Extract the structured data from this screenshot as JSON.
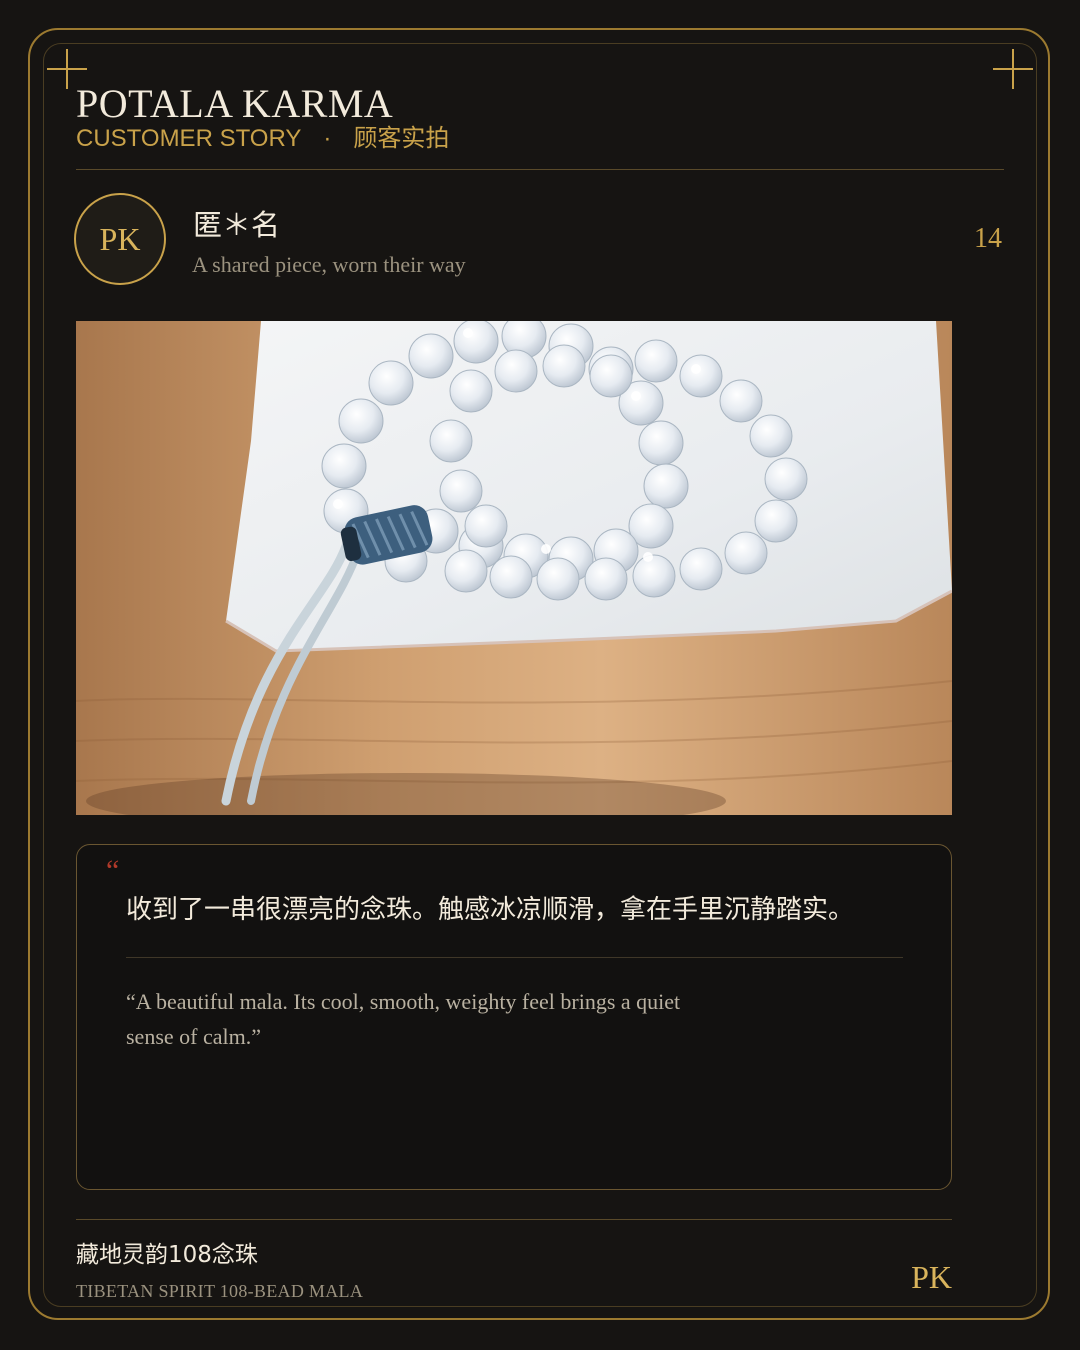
{
  "brand": {
    "name": "POTALA KARMA",
    "tagline_en": "CUSTOMER STORY",
    "tagline_separator": "·",
    "tagline_zh": "顾客实拍"
  },
  "reviewer": {
    "avatar_initials": "PK",
    "name": "匿＊名",
    "subtitle": "A shared piece, worn their way"
  },
  "story_number": "14",
  "photo": {
    "subject": "white bead mala on a white pouch over a wooden table",
    "colors": {
      "wood": "#c99a6c",
      "cloth": "#eef0f2",
      "beads": "#e7ecf2",
      "knot": "#3d5f7e"
    }
  },
  "quote": {
    "mark": "“",
    "text_zh": "收到了一串很漂亮的念珠。触感冰凉顺滑，拿在手里沉静踏实。",
    "text_en": "“A beautiful mala. Its cool, smooth, weighty feel brings a quiet sense of calm.”"
  },
  "product": {
    "name_zh": "藏地灵韵108念珠",
    "name_en": "TIBETAN SPIRIT 108-BEAD MALA"
  },
  "footer": {
    "logo": "PK"
  },
  "colors": {
    "background": "#161412",
    "gold": "#c9a24a",
    "quote_mark": "#b23a2a",
    "text_primary": "#f2eadb",
    "text_muted": "#9b927f"
  },
  "icons": [
    "corner-plus-icon",
    "quote-mark-icon"
  ]
}
